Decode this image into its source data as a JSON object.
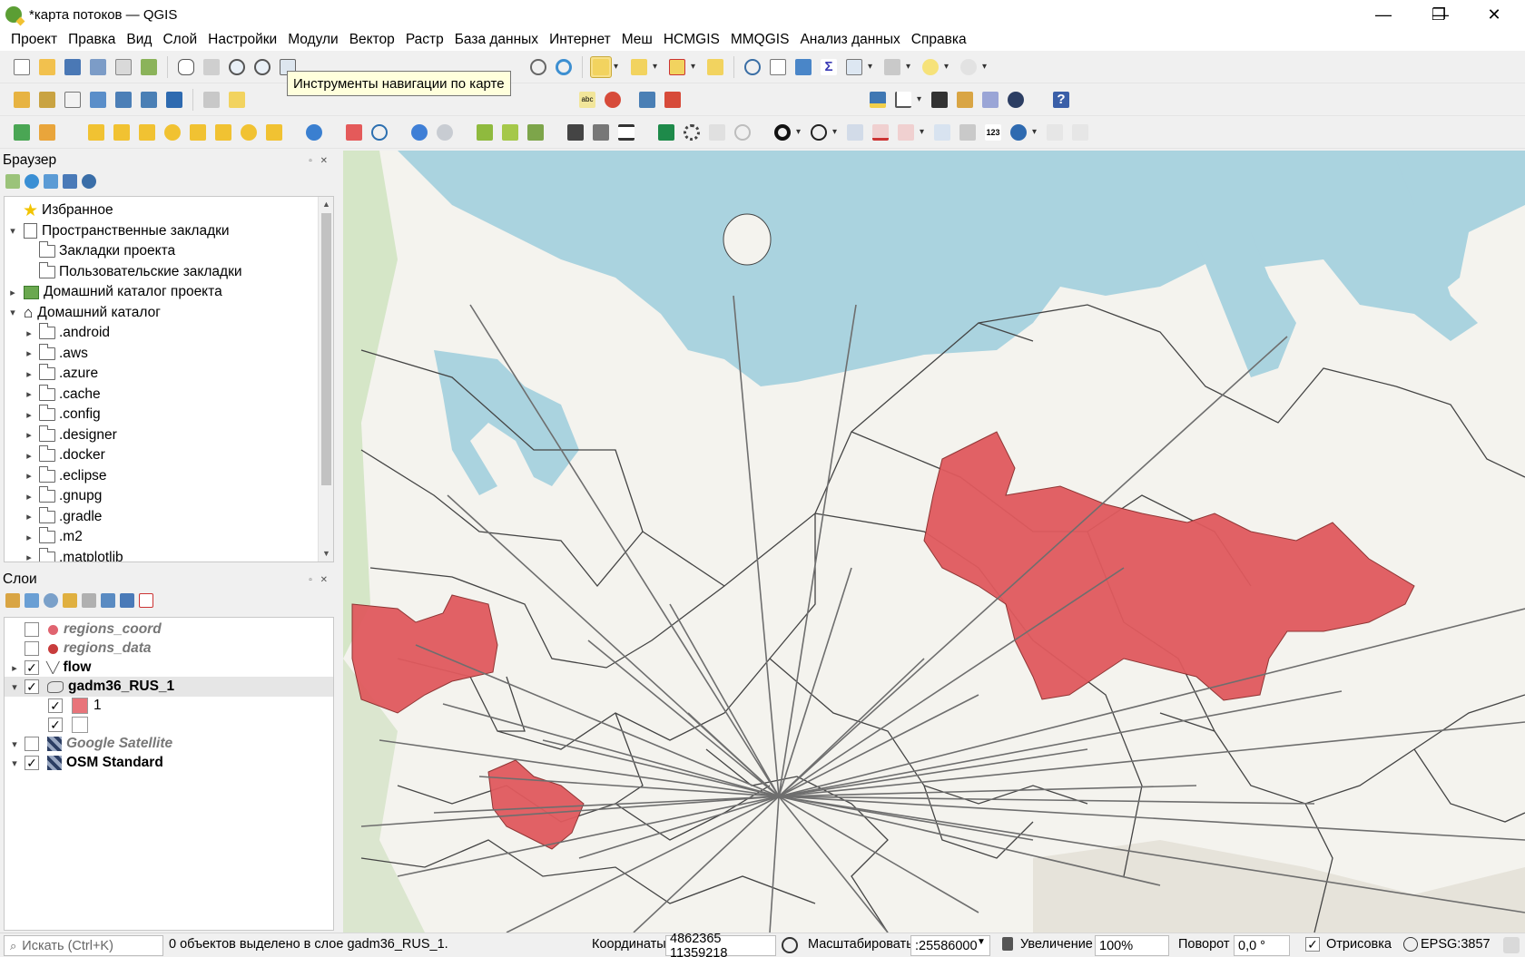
{
  "window": {
    "title": "*карта потоков — QGIS",
    "minimize": "—",
    "maximize": "❐",
    "close": "✕"
  },
  "menu": [
    "Проект",
    "Правка",
    "Вид",
    "Слой",
    "Настройки",
    "Модули",
    "Вектор",
    "Растр",
    "База данных",
    "Интернет",
    "Меш",
    "HCMGIS",
    "MMQGIS",
    "Анализ данных",
    "Справка"
  ],
  "tooltip": "Инструменты навигации по карте",
  "browser": {
    "title": "Браузер",
    "items": [
      {
        "label": "Избранное",
        "level": 0,
        "arrow": "",
        "icon": "star"
      },
      {
        "label": "Пространственные закладки",
        "level": 0,
        "arrow": "▾",
        "icon": "book"
      },
      {
        "label": "Закладки проекта",
        "level": 1,
        "arrow": "",
        "icon": "folder"
      },
      {
        "label": "Пользовательские закладки",
        "level": 1,
        "arrow": "",
        "icon": "folder"
      },
      {
        "label": "Домашний каталог проекта",
        "level": 0,
        "arrow": "▸",
        "icon": "project"
      },
      {
        "label": "Домашний каталог",
        "level": 0,
        "arrow": "▾",
        "icon": "home"
      },
      {
        "label": ".android",
        "level": 1,
        "arrow": "▸",
        "icon": "folder"
      },
      {
        "label": ".aws",
        "level": 1,
        "arrow": "▸",
        "icon": "folder"
      },
      {
        "label": ".azure",
        "level": 1,
        "arrow": "▸",
        "icon": "folder"
      },
      {
        "label": ".cache",
        "level": 1,
        "arrow": "▸",
        "icon": "folder"
      },
      {
        "label": ".config",
        "level": 1,
        "arrow": "▸",
        "icon": "folder"
      },
      {
        "label": ".designer",
        "level": 1,
        "arrow": "▸",
        "icon": "folder"
      },
      {
        "label": ".docker",
        "level": 1,
        "arrow": "▸",
        "icon": "folder"
      },
      {
        "label": ".eclipse",
        "level": 1,
        "arrow": "▸",
        "icon": "folder"
      },
      {
        "label": ".gnupg",
        "level": 1,
        "arrow": "▸",
        "icon": "folder"
      },
      {
        "label": ".gradle",
        "level": 1,
        "arrow": "▸",
        "icon": "folder"
      },
      {
        "label": ".m2",
        "level": 1,
        "arrow": "▸",
        "icon": "folder"
      },
      {
        "label": ".matplotlib",
        "level": 1,
        "arrow": "▸",
        "icon": "folder"
      }
    ]
  },
  "layers": {
    "title": "Слои",
    "items": [
      {
        "label": "regions_coord",
        "checked": false,
        "style": "italic",
        "icon": "dot",
        "color": "#e06470",
        "arrow": ""
      },
      {
        "label": "regions_data",
        "checked": false,
        "style": "italic",
        "icon": "dot",
        "color": "#c83c3c",
        "arrow": ""
      },
      {
        "label": "flow",
        "checked": true,
        "style": "bold",
        "icon": "line",
        "arrow": "▸"
      },
      {
        "label": "gadm36_RUS_1",
        "checked": true,
        "style": "bold",
        "icon": "polygon",
        "arrow": "▾",
        "selected": true
      },
      {
        "label": "1",
        "checked": true,
        "style": "normal",
        "icon": "swatch",
        "color": "#e8747a",
        "arrow": "",
        "sub": true
      },
      {
        "label": "",
        "checked": true,
        "style": "normal",
        "icon": "swatch",
        "color": "#ffffff",
        "arrow": "",
        "sub": true
      },
      {
        "label": "Google Satellite",
        "checked": false,
        "style": "italic",
        "icon": "raster",
        "arrow": "▾"
      },
      {
        "label": "OSM Standard",
        "checked": true,
        "style": "bold",
        "icon": "raster",
        "arrow": "▾"
      }
    ]
  },
  "status": {
    "search_placeholder": "Искать (Ctrl+K)",
    "selection": "0 объектов выделено в слое gadm36_RUS_1.",
    "coord_label": "Координаты",
    "coord_value": "4862365 11359218",
    "scale_label": "Масштабировать",
    "scale_value": ":25586000",
    "magnifier_label": "Увеличение",
    "magnifier_value": "100%",
    "rotation_label": "Поворот",
    "rotation_value": "0,0 °",
    "render_label": "Отрисовка",
    "crs": "EPSG:3857"
  },
  "colors": {
    "water": "#aad3df",
    "region_fill": "#e05a5e",
    "flow_line": "#6e6e6e",
    "borders": "#444444"
  }
}
